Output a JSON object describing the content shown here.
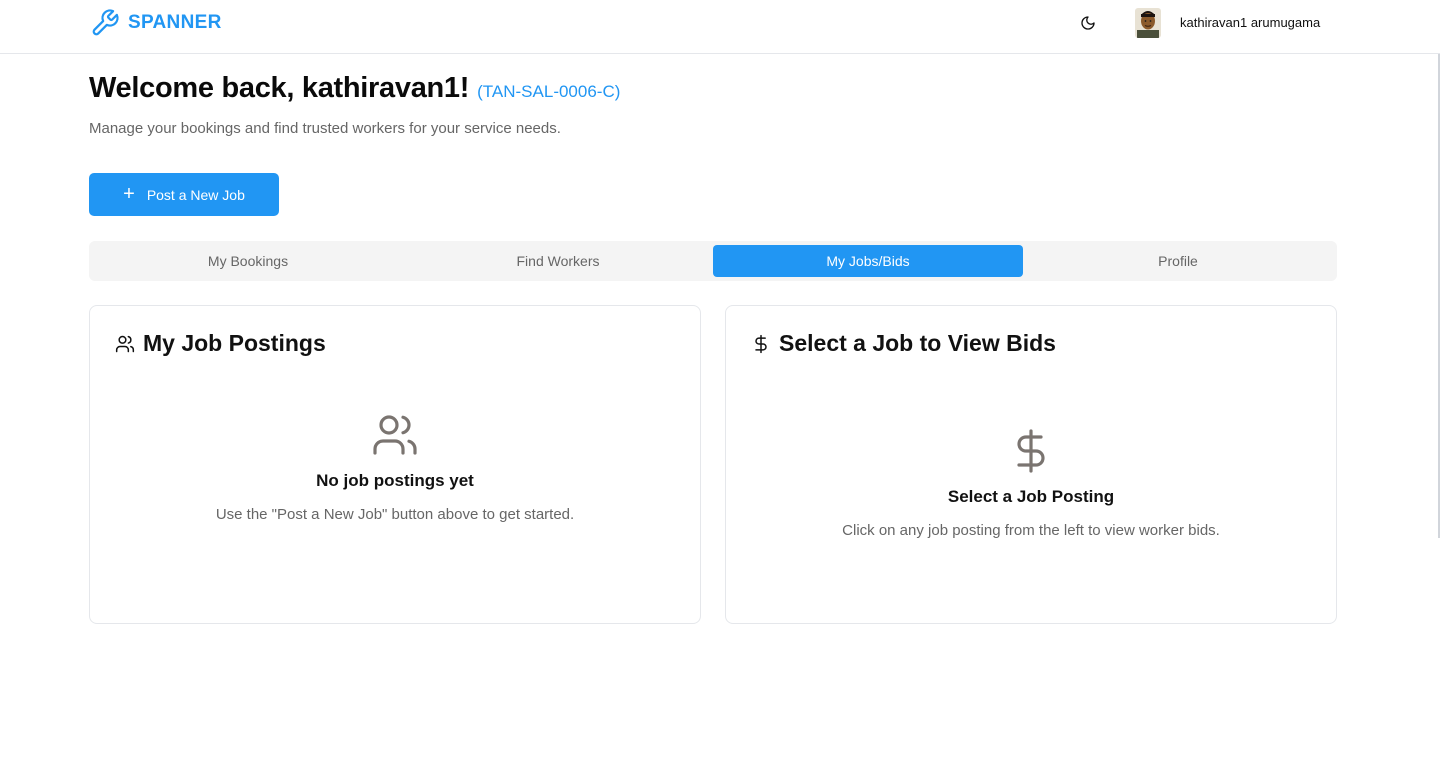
{
  "header": {
    "brand": "SPANNER",
    "user_name": "kathiravan1 arumugama",
    "icons": {
      "brand": "wrench-icon",
      "theme": "moon-icon"
    }
  },
  "welcome": {
    "title": "Welcome back, kathiravan1!",
    "code": "(TAN-SAL-0006-C)",
    "subtitle": "Manage your bookings and find trusted workers for your service needs."
  },
  "actions": {
    "post_job": "Post a New Job"
  },
  "tabs": [
    {
      "label": "My Bookings",
      "active": false
    },
    {
      "label": "Find Workers",
      "active": false
    },
    {
      "label": "My Jobs/Bids",
      "active": true
    },
    {
      "label": "Profile",
      "active": false
    }
  ],
  "postings": {
    "title": "My Job Postings",
    "empty_title": "No job postings yet",
    "empty_text": "Use the \"Post a New Job\" button above to get started."
  },
  "bids": {
    "title": "Select a Job to View Bids",
    "empty_title": "Select a Job Posting",
    "empty_text": "Click on any job posting from the left to view worker bids."
  },
  "colors": {
    "accent": "#2196f3",
    "muted_text": "#666666",
    "tab_bg": "#f4f4f4"
  }
}
